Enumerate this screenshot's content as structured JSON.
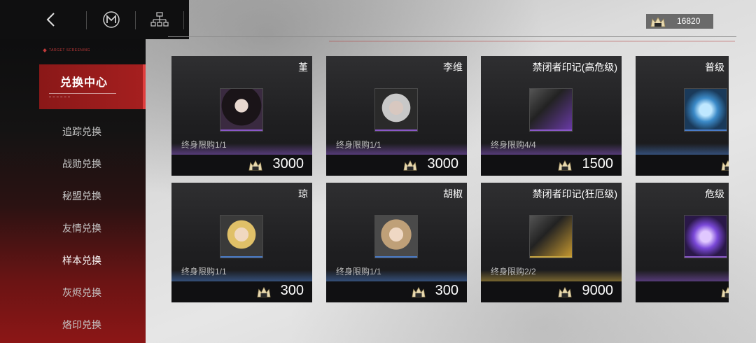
{
  "header": {
    "back_icon": "chevron-left-icon",
    "emblem_icon": "m-emblem-icon",
    "tree_icon": "hierarchy-icon",
    "currency_icon": "crown-coin-icon",
    "currency_amount": "16820"
  },
  "sidebar": {
    "tag": "TARGET SCREENING",
    "active": "兑换中心",
    "items": [
      "追踪兑换",
      "战勋兑换",
      "秘盟兑换",
      "友情兑换",
      "样本兑换",
      "灰烬兑换",
      "烙印兑换"
    ]
  },
  "cards": [
    {
      "name": "堇",
      "limit": "终身限购1/1",
      "price": "3000",
      "accent": "#8a58c8"
    },
    {
      "name": "李维",
      "limit": "终身限购1/1",
      "price": "3000",
      "accent": "#8a58c8"
    },
    {
      "name": "禁闭者印记(高危级)",
      "limit": "终身限购4/4",
      "price": "1500",
      "accent": "#8a58c8"
    },
    {
      "name": "普级",
      "limit": "",
      "price": "",
      "accent": "#4a7cc8"
    },
    {
      "name": "琼",
      "limit": "终身限购1/1",
      "price": "300",
      "accent": "#4a7cc8"
    },
    {
      "name": "胡椒",
      "limit": "终身限购1/1",
      "price": "300",
      "accent": "#4a7cc8"
    },
    {
      "name": "禁闭者印记(狂厄级)",
      "limit": "终身限购2/2",
      "price": "9000",
      "accent": "#c8a640"
    },
    {
      "name": "危级",
      "limit": "",
      "price": "",
      "accent": "#8a58c8"
    }
  ],
  "colors": {
    "brand_red": "#a51f1f",
    "rare_purple": "#8a58c8",
    "rare_blue": "#4a7cc8",
    "rare_gold": "#c8a640"
  }
}
